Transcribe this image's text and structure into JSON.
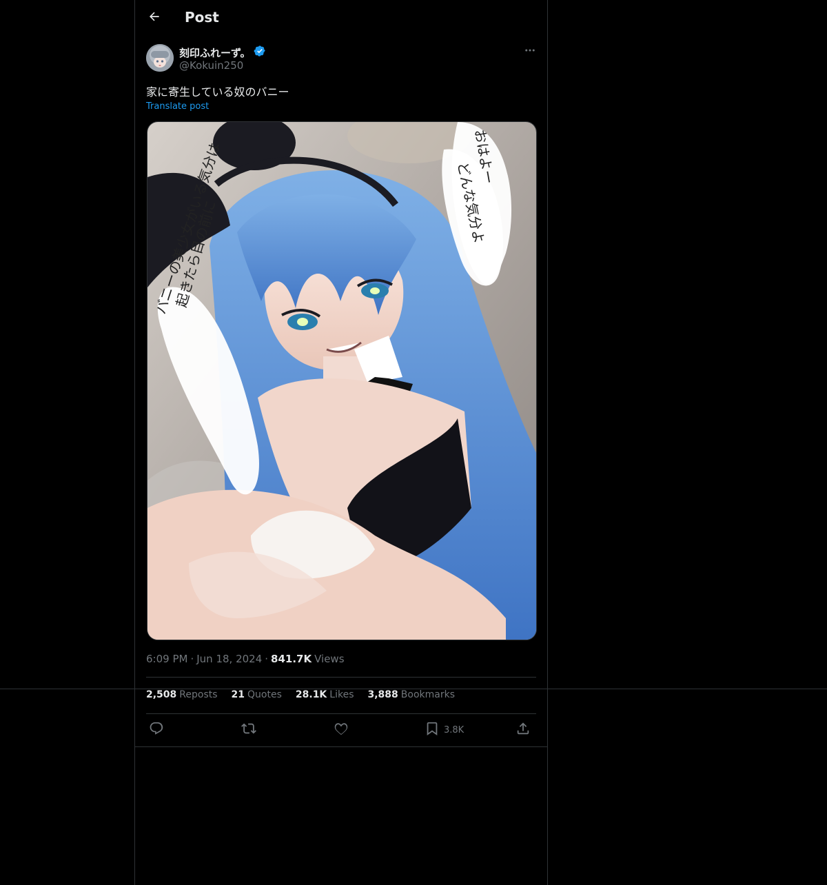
{
  "header": {
    "title": "Post",
    "back_icon": "back-arrow-icon"
  },
  "author": {
    "display_name": "刻印ふれーず。",
    "handle": "@Kokuin250",
    "verified": true,
    "verified_color": "#1d9bf0"
  },
  "post": {
    "text": "家に寄生している奴のバニー",
    "translate_label": "Translate post",
    "image": {
      "speech_right": [
        "おはよー",
        "どんな気分よ"
      ],
      "speech_left": [
        "起きたら目の前に",
        "バニーの美少女がいる気分は"
      ]
    }
  },
  "meta": {
    "time": "6:09 PM",
    "sep1": "·",
    "date": "Jun 18, 2024",
    "sep2": "·",
    "views_count": "841.7K",
    "views_label": "Views"
  },
  "stats": {
    "reposts_count": "2,508",
    "reposts_label": "Reposts",
    "quotes_count": "21",
    "quotes_label": "Quotes",
    "likes_count": "28.1K",
    "likes_label": "Likes",
    "bookmarks_count": "3,888",
    "bookmarks_label": "Bookmarks"
  },
  "actions": {
    "reply_icon": "reply-icon",
    "repost_icon": "repost-icon",
    "like_icon": "heart-icon",
    "bookmark_icon": "bookmark-icon",
    "bookmark_count": "3.8K",
    "share_icon": "share-icon"
  },
  "colors": {
    "background": "#000000",
    "text_primary": "#e7e9ea",
    "text_secondary": "#71767b",
    "link": "#1d9bf0",
    "border": "#2f3336"
  }
}
